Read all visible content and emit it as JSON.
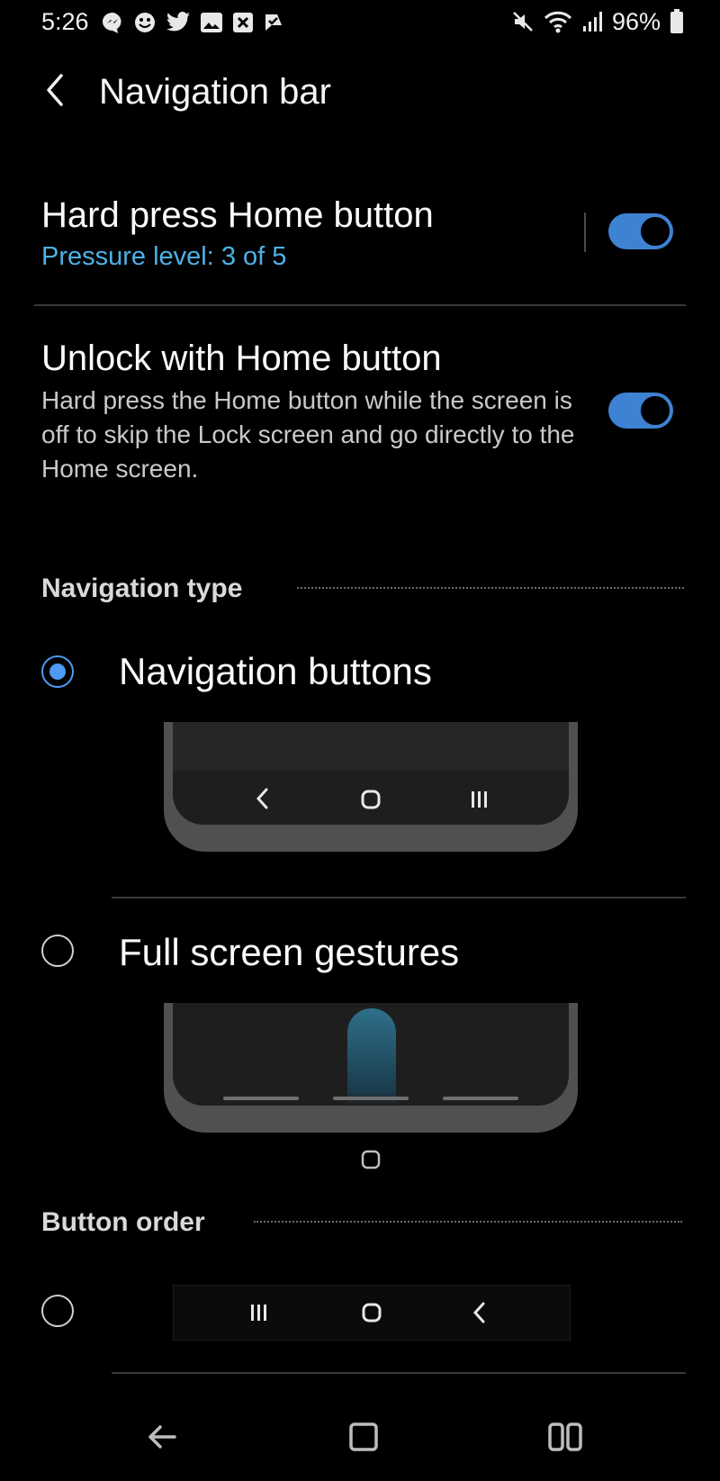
{
  "status_bar": {
    "time": "5:26",
    "battery": "96%"
  },
  "header": {
    "title": "Navigation bar"
  },
  "settings": {
    "hard_press": {
      "title": "Hard press Home button",
      "subtitle": "Pressure level: 3 of 5",
      "enabled": true
    },
    "unlock_home": {
      "title": "Unlock with Home button",
      "description": "Hard press the Home button while the screen is off to skip the Lock screen and go directly to the Home screen.",
      "enabled": true
    }
  },
  "navigation_type": {
    "header": "Navigation type",
    "options": [
      {
        "label": "Navigation buttons",
        "selected": true
      },
      {
        "label": "Full screen gestures",
        "selected": false
      }
    ]
  },
  "button_order": {
    "header": "Button order"
  },
  "colors": {
    "accent": "#3e82d4",
    "subtitle": "#4eb1e6",
    "background": "#000000"
  },
  "icons": {
    "status_left": [
      "messenger-icon",
      "emoji-icon",
      "twitter-icon",
      "gallery-icon",
      "close-box-icon",
      "check-flag-icon"
    ],
    "status_right": [
      "mute-icon",
      "wifi-icon",
      "signal-icon",
      "battery-icon"
    ],
    "bottom_nav": [
      "back-arrow-icon",
      "home-icon",
      "recents-icon"
    ]
  }
}
